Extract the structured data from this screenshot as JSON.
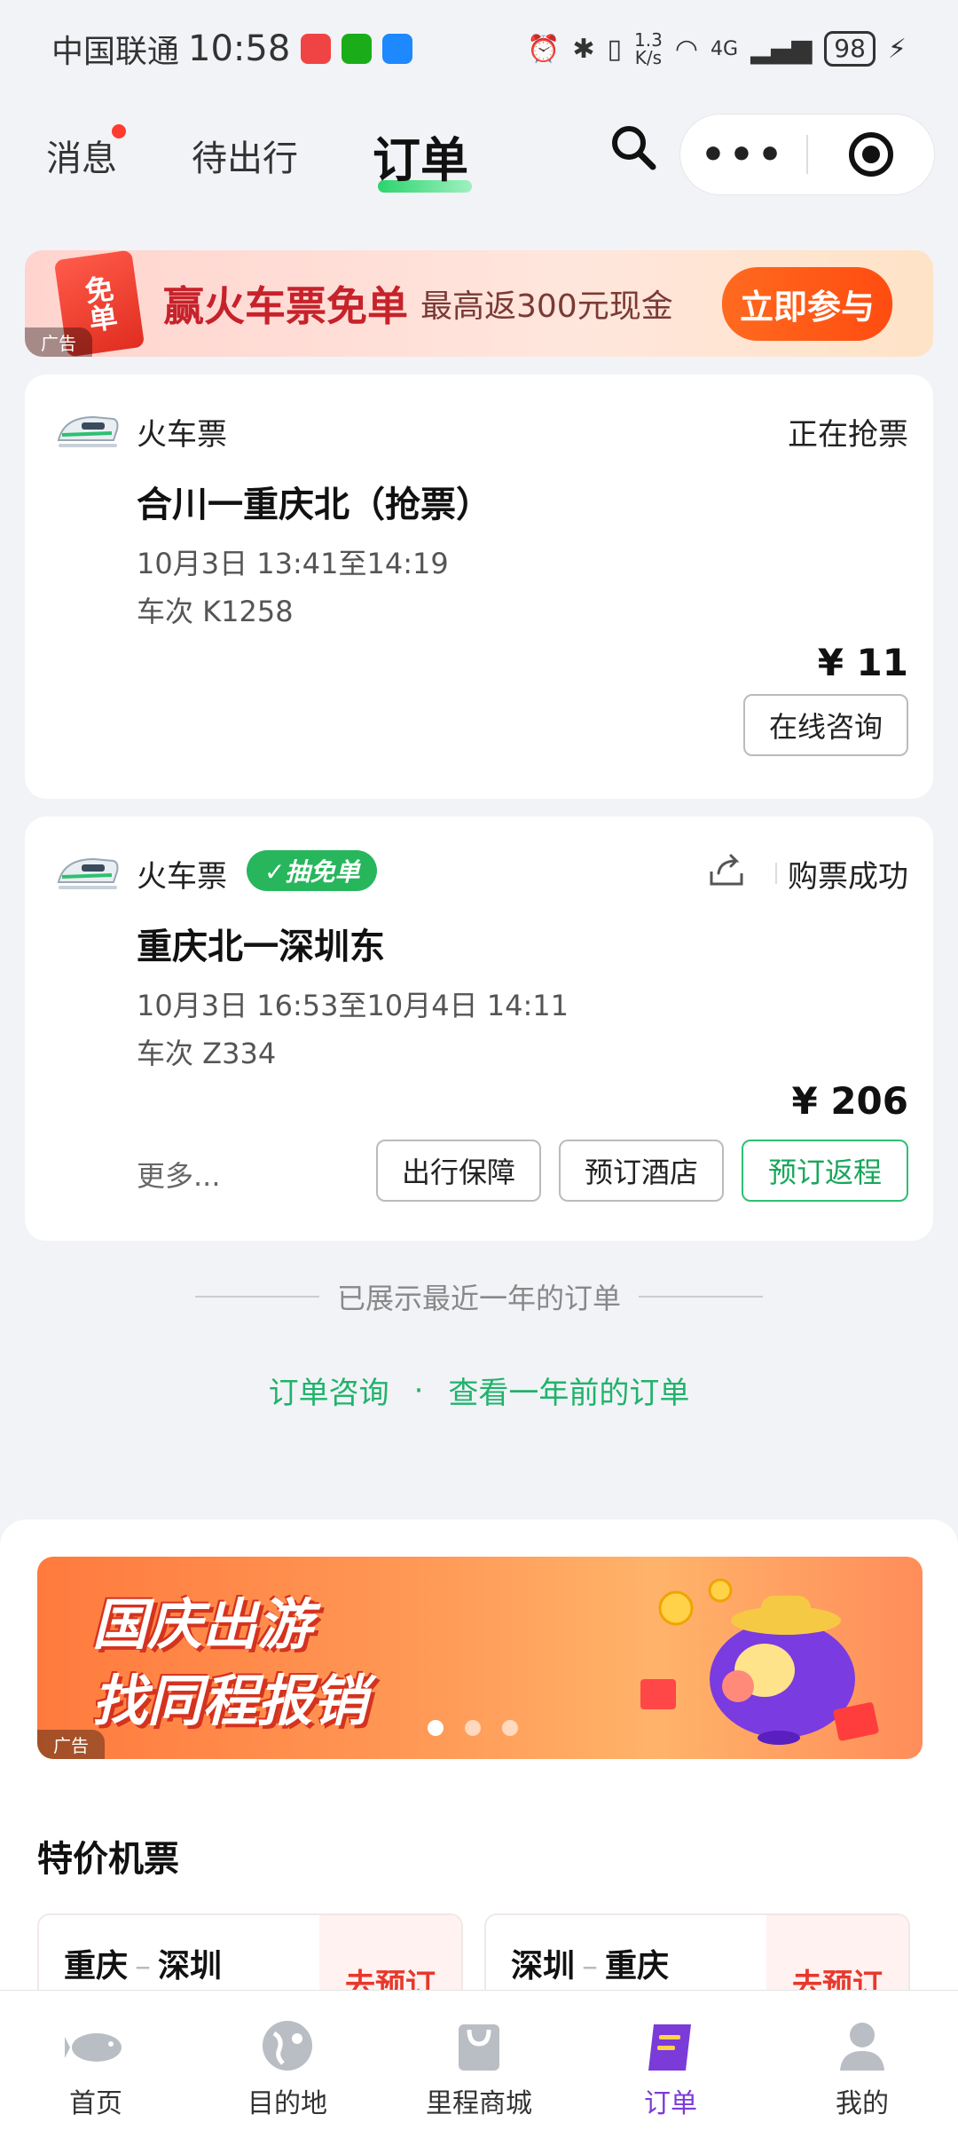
{
  "status_bar": {
    "carrier": "中国联通",
    "time": "10:58",
    "net_speed_value": "1.3",
    "net_speed_unit": "K/s",
    "network": "4G",
    "battery": "98"
  },
  "top_tabs": [
    {
      "label": "消息",
      "has_dot": true
    },
    {
      "label": "待出行"
    },
    {
      "label": "订单",
      "active": true
    }
  ],
  "ad_banner": {
    "badge_text": "免单",
    "title": "赢火车票免单",
    "subtitle": "最高返300元现金",
    "button": "立即参与",
    "ad_tag": "广告"
  },
  "orders": [
    {
      "type": "火车票",
      "status": "正在抢票",
      "route": "合川一重庆北（抢票）",
      "time": "10月3日 13:41至14:19",
      "train_no": "车次 K1258",
      "price": "¥ 11",
      "buttons": [
        "在线咨询"
      ]
    },
    {
      "type": "火车票",
      "badge": "✓抽免单",
      "status": "购票成功",
      "route": "重庆北一深圳东",
      "time": "10月3日 16:53至10月4日 14:11",
      "train_no": "车次 Z334",
      "price": "¥ 206",
      "more": "更多...",
      "buttons": [
        "出行保障",
        "预订酒店",
        "预订返程"
      ]
    }
  ],
  "divider_text": "已展示最近一年的订单",
  "links": {
    "consult": "订单咨询",
    "separator": "·",
    "older": "查看一年前的订单"
  },
  "promo": {
    "line1": "国庆出游",
    "line2": "找同程报销",
    "ad_tag": "广告"
  },
  "section_title": "特价机票",
  "flights": [
    {
      "from": "重庆",
      "to": "深圳",
      "dash": "–",
      "action": "去预订"
    },
    {
      "from": "深圳",
      "to": "重庆",
      "dash": "–",
      "action": "去预订"
    }
  ],
  "bottom_nav": [
    {
      "label": "首页",
      "icon": "home-fish-icon"
    },
    {
      "label": "目的地",
      "icon": "globe-icon"
    },
    {
      "label": "里程商城",
      "icon": "shopping-bag-icon"
    },
    {
      "label": "订单",
      "icon": "order-book-icon",
      "active": true
    },
    {
      "label": "我的",
      "icon": "user-icon"
    }
  ],
  "colors": {
    "accent_green": "#1fb36a",
    "nav_active": "#7b3bd9",
    "price_red": "#e8382c"
  }
}
